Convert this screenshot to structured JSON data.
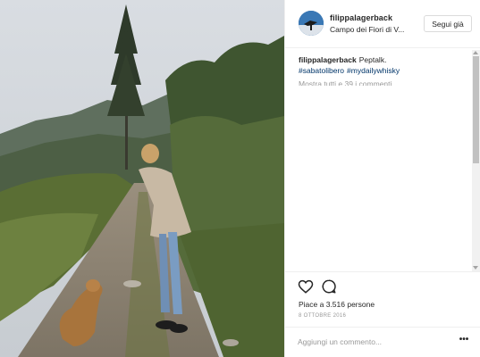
{
  "post": {
    "username": "filippalagerback",
    "location": "Campo dei Fiori di V...",
    "follow_label": "Segui già",
    "caption": {
      "username": "filippalagerback",
      "text": "Peptalk.",
      "hashtags": [
        "#sabatolibero",
        "#mydailywhisky"
      ]
    },
    "more_comments_label": "Mostra tutti e 39 i commenti",
    "likes_label": "Piace a 3.516 persone",
    "date_label": "8 OTTOBRE 2016",
    "comment_placeholder": "Aggiungi un commento...",
    "more_options_glyph": "•••"
  },
  "icons": {
    "like": "heart-outline-icon",
    "comment": "speech-bubble-icon",
    "options": "ellipsis-icon"
  },
  "colors": {
    "text": "#262626",
    "secondary_text": "#999999",
    "hashtag": "#003569",
    "border": "#efefef"
  }
}
